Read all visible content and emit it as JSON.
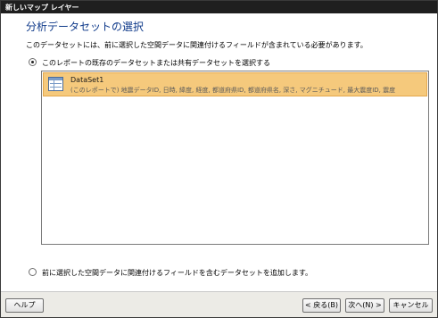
{
  "window": {
    "title": "新しいマップ レイヤー"
  },
  "page": {
    "heading": "分析データセットの選択",
    "description": "このデータセットには、前に選択した空間データに関連付けるフィールドが含まれている必要があります。"
  },
  "options": {
    "existing_label": "このレポートの既存のデータセットまたは共有データセットを選択する",
    "existing_checked": true,
    "new_label": "前に選択した空間データに関連付けるフィールドを含むデータセットを追加します。",
    "new_checked": false
  },
  "datasets": [
    {
      "name": "DataSet1",
      "fields": "(このレポートで) 地震データID, 日時, 緯度, 経度, 都道府県ID, 都道府県名, 深さ, マグニチュード, 最大震度ID, 震度"
    }
  ],
  "buttons": {
    "help": "ヘルプ",
    "back": "< 戻る(B)",
    "next": "次へ(N) >",
    "cancel": "キャンセル"
  },
  "colors": {
    "heading": "#0f3a8a",
    "selected_row": "#f5c97c",
    "title_bar": "#1f1f1f"
  }
}
